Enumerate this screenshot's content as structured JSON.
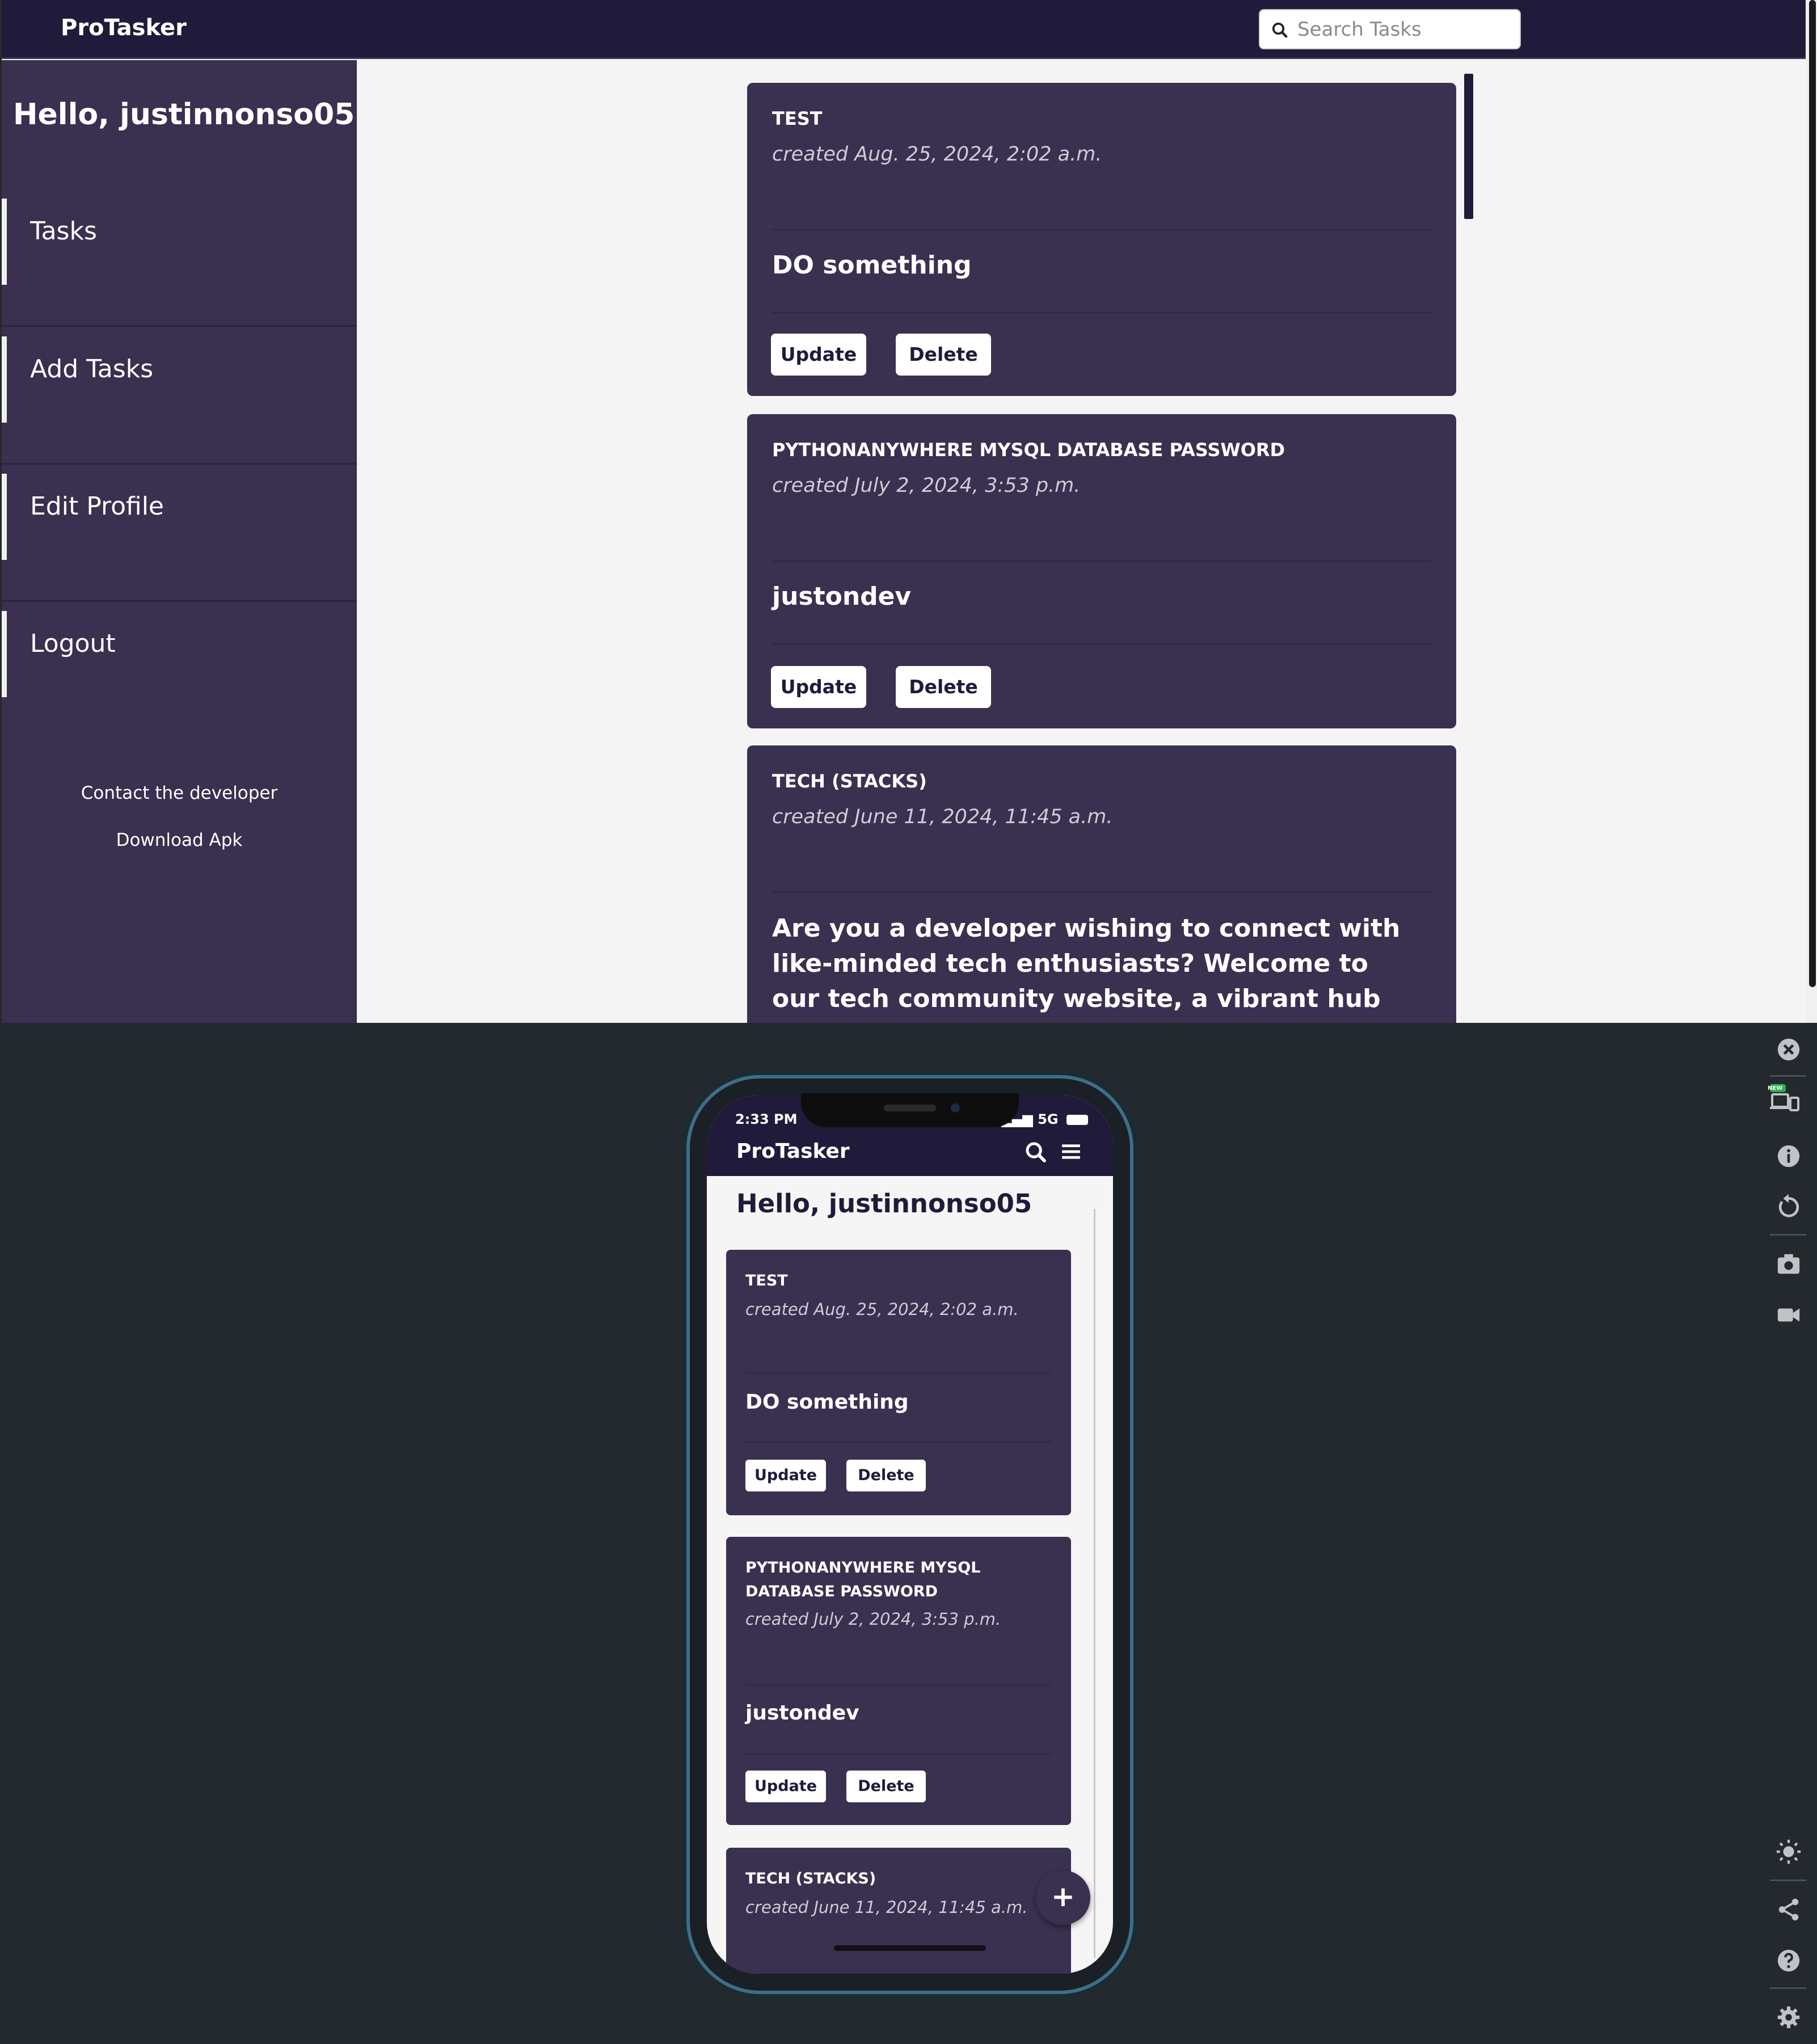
{
  "app": {
    "name": "ProTasker"
  },
  "search": {
    "placeholder": "Search Tasks"
  },
  "user": {
    "greeting": "Hello, justinnonso05"
  },
  "sidebar": {
    "items": [
      {
        "label": "Tasks"
      },
      {
        "label": "Add Tasks"
      },
      {
        "label": "Edit Profile"
      },
      {
        "label": "Logout"
      }
    ],
    "links": [
      {
        "label": "Contact the developer"
      },
      {
        "label": "Download Apk"
      }
    ]
  },
  "tasks": [
    {
      "title": "TEST",
      "created": "created Aug. 25, 2024, 2:02 a.m.",
      "body": "DO something"
    },
    {
      "title": "PYTHONANYWHERE MYSQL DATABASE PASSWORD",
      "created": "created July 2, 2024, 3:53 p.m.",
      "body": "justondev"
    },
    {
      "title": "TECH (STACKS)",
      "created": "created June 11, 2024, 11:45 a.m.",
      "body": "Are you a developer wishing to connect with like-minded tech enthusiasts? Welcome to our tech community website, a vibrant hub for developers,"
    }
  ],
  "mobile_tasks": [
    {
      "title": "TEST",
      "created": "created Aug. 25, 2024, 2:02 a.m.",
      "body": "DO something"
    },
    {
      "title": "PYTHONANYWHERE MYSQL DATABASE PASSWORD",
      "created": "created July 2, 2024, 3:53 p.m.",
      "body": "justondev"
    },
    {
      "title": "TECH (STACKS)",
      "created": "created June 11, 2024, 11:45 a.m."
    }
  ],
  "actions": {
    "update": "Update",
    "delete": "Delete"
  },
  "mobile": {
    "status_time": "2:33 PM",
    "status_network": "5G",
    "fab_label": "+"
  },
  "toolbar_badge": "NEW",
  "colors": {
    "navbar": "#201b3a",
    "panel": "#3a3050",
    "background": "#f4f4f4"
  },
  "icons": [
    "search-icon",
    "menu-icon",
    "close-icon",
    "device-icon",
    "info-icon",
    "rotate-icon",
    "camera-icon",
    "video-icon",
    "brightness-icon",
    "share-icon",
    "help-icon",
    "settings-icon"
  ]
}
